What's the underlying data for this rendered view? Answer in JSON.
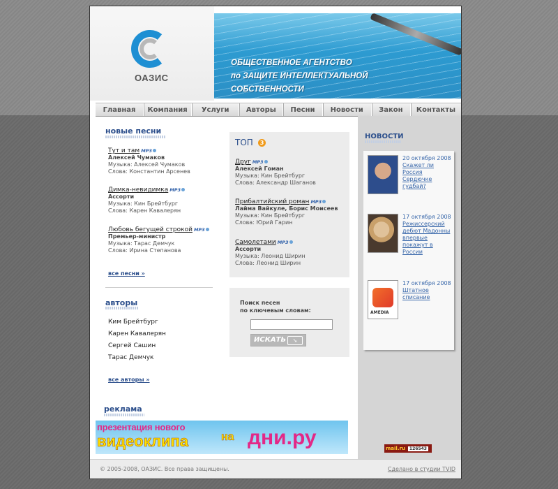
{
  "header": {
    "logo_text": "ОАЗИС",
    "banner_line1": "ОБЩЕСТВЕННОЕ АГЕНТСТВО",
    "banner_line2": "по ЗАЩИТЕ ИНТЕЛЛЕКТУАЛЬНОЙ",
    "banner_line3": "СОБСТВЕННОСТИ"
  },
  "nav": [
    "Главная",
    "Компания",
    "Услуги",
    "Авторы",
    "Песни",
    "Новости",
    "Закон",
    "Контакты"
  ],
  "new_songs": {
    "heading": "новые песни",
    "items": [
      {
        "title": "Тут и там",
        "badge": "MP3",
        "artist": "Алексей Чумаков",
        "music": "Музыка: Алексей Чумаков",
        "lyrics": "Слова: Константин Арсенев"
      },
      {
        "title": "Димка-невидимка",
        "badge": "MP3",
        "artist": "Ассорти",
        "music": "Музыка: Кин Брейтбург",
        "lyrics": "Слова: Карен Кавалерян"
      },
      {
        "title": "Любовь бегущей строкой",
        "badge": "MP3",
        "artist": "Премьер-министр",
        "music": "Музыка: Тарас Демчук",
        "lyrics": "Слова: Ирина Степанова"
      }
    ],
    "more": "все песни »"
  },
  "top": {
    "heading": "ТОП",
    "badge_num": "3",
    "items": [
      {
        "title": "Друг",
        "badge": "MP3",
        "artist": "Алексей Гоман",
        "music": "Музыка: Кин Брейтбург",
        "lyrics": "Слова: Александр Шаганов"
      },
      {
        "title": "Прибалтийский роман",
        "badge": "MP3",
        "artist": "Лайма Вайкуле, Борис Моисеев",
        "music": "Музыка: Кин Брейтбург",
        "lyrics": "Слова: Юрий Гарин"
      },
      {
        "title": "Самолетами",
        "badge": "MP3",
        "artist": "Ассорти",
        "music": "Музыка: Леонид Ширин",
        "lyrics": "Слова: Леонид Ширин"
      }
    ]
  },
  "search": {
    "label1": "Поиск песен",
    "label2": "по ключевым словам:",
    "placeholder": "",
    "button": "ИСКАТЬ"
  },
  "authors": {
    "heading": "авторы",
    "items": [
      "Ким Брейтбург",
      "Карен Кавалерян",
      "Сергей Сашин",
      "Тарас Демчук"
    ],
    "more": "все авторы »"
  },
  "ads": {
    "heading": "реклама",
    "line1": "презентация нового",
    "line2": "видеоклипа",
    "line3": "на",
    "line4": "дни.ру"
  },
  "news": {
    "heading": "НОВОСТИ",
    "items": [
      {
        "date": "20 октября 2008",
        "title": "Скажет ли Россия Сердючке гудбай?"
      },
      {
        "date": "17 октября 2008",
        "title": "Режиссерский дебют Мадонны впервые покажут в России"
      },
      {
        "date": "17 октября 2008",
        "title": "Штатное списание"
      }
    ],
    "amedia_label": "AMEDIA"
  },
  "counter": {
    "brand": "mail.ru",
    "value": "126543"
  },
  "footer": {
    "copyright": "© 2005-2008, ОАЗИС. Все права защищены.",
    "studio": "Сделано в студии TVID"
  },
  "colors": {
    "accent": "#2c4f8c",
    "banner": "#2d9bd1",
    "logo_blue": "#1e8fd3"
  }
}
